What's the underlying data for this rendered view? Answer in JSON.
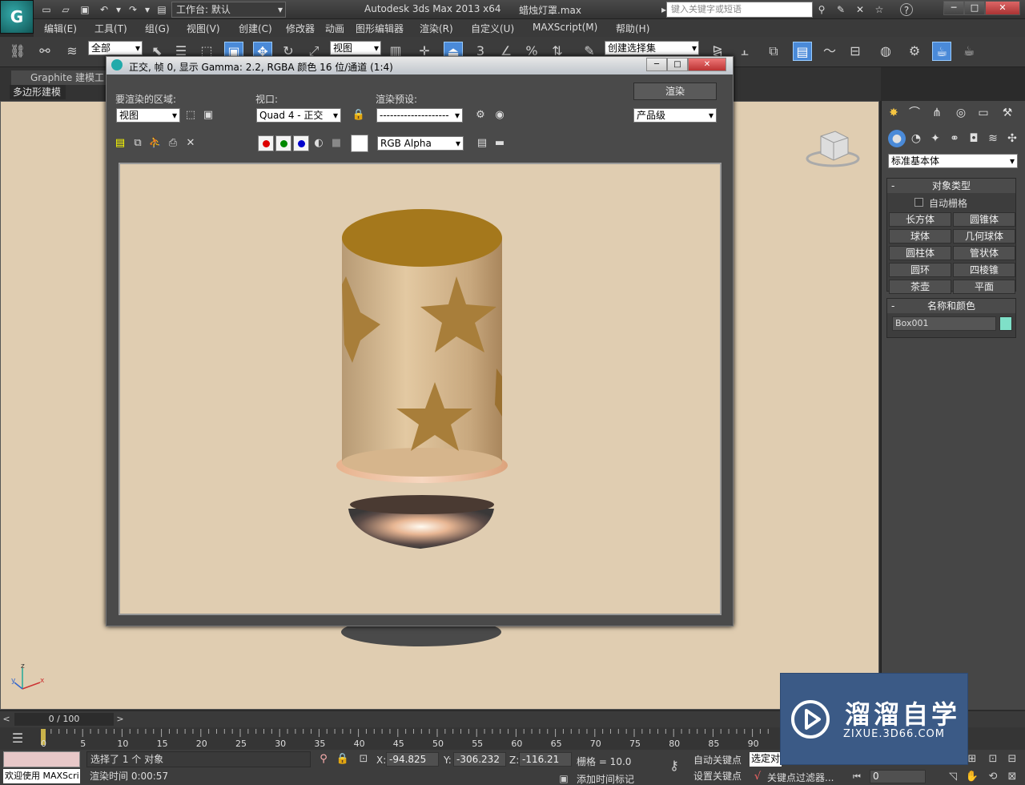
{
  "titlebar": {
    "workspace": "工作台: 默认",
    "app_title": "Autodesk 3ds Max  2013 x64",
    "file_title": "蜡烛灯罩.max",
    "search_placeholder": "键入关键字或短语",
    "help_label": "?",
    "logo_letter": "G"
  },
  "menu": {
    "items": [
      "编辑(E)",
      "工具(T)",
      "组(G)",
      "视图(V)",
      "创建(C)",
      "修改器",
      "动画",
      "图形编辑器",
      "渲染(R)",
      "自定义(U)",
      "MAXScript(M)",
      "帮助(H)"
    ]
  },
  "toolbar": {
    "selection_filter": "全部",
    "ref_coord": "视图",
    "named_selection": "创建选择集",
    "snap_label": "3",
    "percent_label": "%"
  },
  "ribbon": {
    "tab": "Graphite 建模工",
    "sub": "多边形建模"
  },
  "render_window": {
    "title": "正交, 帧 0, 显示 Gamma: 2.2, RGBA 颜色 16 位/通道 (1:4)",
    "area_label": "要渲染的区域:",
    "area_value": "视图",
    "viewport_label": "视口:",
    "viewport_value": "Quad 4 - 正交",
    "preset_label": "渲染预设:",
    "preset_value": "--------------------",
    "render_button": "渲染",
    "quality_value": "产品级",
    "channel_value": "RGB Alpha"
  },
  "command_panel": {
    "category": "标准基本体",
    "object_type_header": "对象类型",
    "autogrid_label": "自动栅格",
    "buttons": [
      "长方体",
      "圆锥体",
      "球体",
      "几何球体",
      "圆柱体",
      "管状体",
      "圆环",
      "四棱锥",
      "茶壶",
      "平面"
    ],
    "name_color_header": "名称和颜色",
    "object_name": "Box001",
    "object_color": "#7fe0c8"
  },
  "timeline": {
    "frame_counter": "0 / 100",
    "ticks": [
      "0",
      "5",
      "10",
      "15",
      "20",
      "25",
      "30",
      "35",
      "40",
      "45",
      "50",
      "55",
      "60",
      "65",
      "70",
      "75",
      "80",
      "85",
      "90"
    ]
  },
  "status": {
    "welcome": "欢迎使用 MAXScri",
    "prompt_selection": "选择了 1 个 对象",
    "prompt_render_time": "渲染时间  0:00:57",
    "x_label": "X:",
    "x_value": "-94.825",
    "y_label": "Y:",
    "y_value": "-306.232",
    "z_label": "Z:",
    "z_value": "-116.21",
    "grid": "栅格 = 10.0",
    "add_time_tag": "添加时间标记",
    "auto_key": "自动关键点",
    "set_key": "设置关键点",
    "selected_dd": "选定对",
    "key_filters": "关键点过滤器...",
    "frame_input": "0"
  },
  "watermark": {
    "name": "溜溜自学",
    "url": "ZIXUE.3D66.COM"
  }
}
